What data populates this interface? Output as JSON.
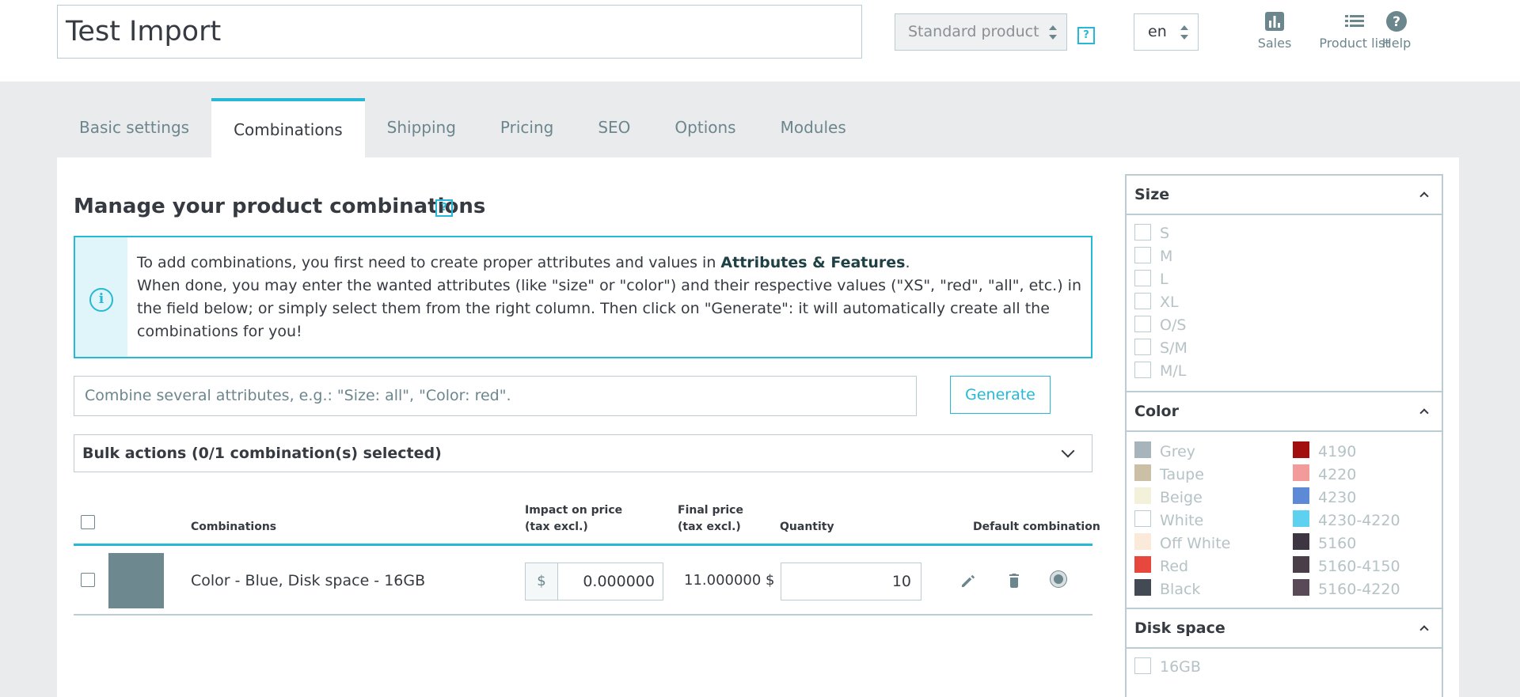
{
  "header": {
    "product_name": "Test Import",
    "product_type": "Standard product",
    "help_label": "?",
    "language": "en",
    "links": [
      {
        "label": "Sales",
        "icon": "bar-chart-icon"
      },
      {
        "label": "Product list",
        "icon": "list-icon"
      },
      {
        "label": "Help",
        "icon": "help-circle-icon"
      }
    ]
  },
  "tabs": [
    {
      "label": "Basic settings",
      "active": false
    },
    {
      "label": "Combinations",
      "active": true
    },
    {
      "label": "Shipping",
      "active": false
    },
    {
      "label": "Pricing",
      "active": false
    },
    {
      "label": "SEO",
      "active": false
    },
    {
      "label": "Options",
      "active": false
    },
    {
      "label": "Modules",
      "active": false
    }
  ],
  "combinations": {
    "title": "Manage your product combinations",
    "info": {
      "line1_prefix": "To add combinations, you first need to create proper attributes and values in ",
      "line1_link": "Attributes & Features",
      "line1_suffix": ".",
      "line2": "When done, you may enter the wanted attributes (like \"size\" or \"color\") and their respective values (\"XS\", \"red\", \"all\", etc.) in the field below; or simply select them from the right column. Then click on \"Generate\": it will automatically create all the combinations for you!"
    },
    "combine_placeholder": "Combine several attributes, e.g.: \"Size: all\", \"Color: red\".",
    "generate_label": "Generate",
    "bulk_label": "Bulk actions (0/1 combination(s) selected)",
    "table": {
      "headers": {
        "combinations": "Combinations",
        "impact": "Impact on price (tax excl.)",
        "final": "Final price (tax excl.)",
        "quantity": "Quantity",
        "default": "Default combination"
      },
      "rows": [
        {
          "label": "Color - Blue, Disk space - 16GB",
          "currency": "$",
          "impact": "0.000000",
          "final_price": "11.000000 $",
          "quantity": "10"
        }
      ]
    }
  },
  "attributes": {
    "size": {
      "title": "Size",
      "values": [
        "S",
        "M",
        "L",
        "XL",
        "O/S",
        "S/M",
        "M/L"
      ]
    },
    "color": {
      "title": "Color",
      "values_left": [
        {
          "name": "Grey",
          "color": "#a8b4bb"
        },
        {
          "name": "Taupe",
          "color": "#cbc0a6"
        },
        {
          "name": "Beige",
          "color": "#f4f1da"
        },
        {
          "name": "White",
          "color": "#ffffff"
        },
        {
          "name": "Off White",
          "color": "#fbe9d9"
        },
        {
          "name": "Red",
          "color": "#e8473e"
        },
        {
          "name": "Black",
          "color": "#434a54"
        }
      ],
      "values_right": [
        {
          "name": "4190",
          "color": "#a30f0f"
        },
        {
          "name": "4220",
          "color": "#f39a9a"
        },
        {
          "name": "4230",
          "color": "#5d8ad6"
        },
        {
          "name": "4230-4220",
          "color": "#5ed0f0"
        },
        {
          "name": "5160",
          "color": "#3d3542"
        },
        {
          "name": "5160-4150",
          "color": "#4a3f49"
        },
        {
          "name": "5160-4220",
          "color": "#5a4a58"
        }
      ]
    },
    "disk": {
      "title": "Disk space",
      "values": [
        "16GB"
      ]
    }
  }
}
